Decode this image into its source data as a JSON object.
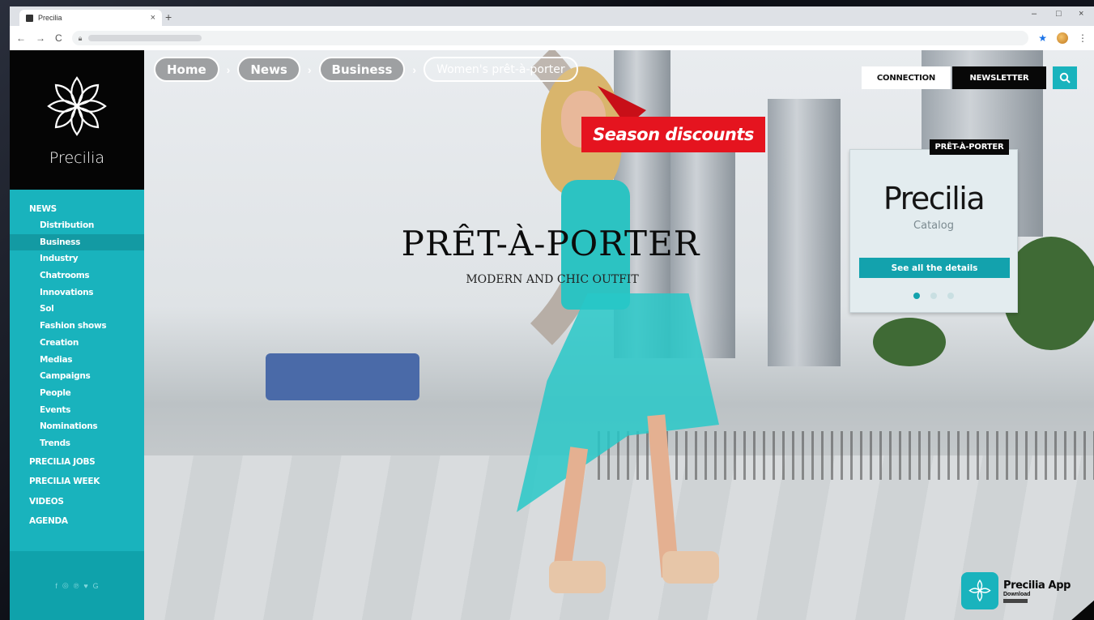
{
  "browser": {
    "tab_title": "Precilia",
    "tab_close": "×",
    "new_tab": "+",
    "window_controls": {
      "minimize": "–",
      "maximize": "□",
      "close": "×"
    },
    "nav": {
      "back": "←",
      "forward": "→",
      "reload": "C",
      "menu": "⋮"
    },
    "address_icon": "lock-icon",
    "bookmark_icon": "star-icon"
  },
  "breadcrumb": [
    {
      "label": "Home"
    },
    {
      "label": "News"
    },
    {
      "label": "Business"
    },
    {
      "label": "Women's prêt-à-porter"
    }
  ],
  "breadcrumb_separator": "›",
  "header": {
    "connection_label": "CONNECTION",
    "newsletter_label": "NEWSLETTER",
    "search_icon": "search-icon"
  },
  "brand": {
    "name": "Precilia",
    "logo_icon": "lotus-mandala-icon"
  },
  "sidebar": {
    "accent_color": "#19b3bd",
    "sections": [
      {
        "label": "NEWS",
        "items": [
          {
            "label": "Distribution",
            "active": false
          },
          {
            "label": "Business",
            "active": true
          },
          {
            "label": "Industry",
            "active": false
          },
          {
            "label": "Chatrooms",
            "active": false
          },
          {
            "label": "Innovations",
            "active": false
          },
          {
            "label": "Sol",
            "active": false
          },
          {
            "label": "Fashion shows",
            "active": false
          },
          {
            "label": "Creation",
            "active": false
          },
          {
            "label": "Medias",
            "active": false
          },
          {
            "label": "Campaigns",
            "active": false
          },
          {
            "label": "People",
            "active": false
          },
          {
            "label": "Events",
            "active": false
          },
          {
            "label": "Nominations",
            "active": false
          },
          {
            "label": "Trends",
            "active": false
          }
        ]
      },
      {
        "label": "PRECILIA JOBS"
      },
      {
        "label": "PRECILIA WEEK"
      },
      {
        "label": "VIDEOS"
      },
      {
        "label": "AGENDA"
      }
    ],
    "social_icons": [
      "facebook-icon",
      "instagram-icon",
      "pinterest-icon",
      "twitter-icon",
      "google-plus-icon"
    ]
  },
  "hero": {
    "promo": "Season discounts",
    "promo_color": "#e5141f",
    "headline": "PRÊT-À-PORTER",
    "subheadline": "MODERN AND CHIC OUTFIT"
  },
  "catalog_card": {
    "tag": "PRÊT-À-PORTER",
    "brand": "Precilia",
    "subtitle": "Catalog",
    "button": "See all the details",
    "slides": 3,
    "active_slide": 1
  },
  "app_badge": {
    "title": "Precilia App",
    "subtitle": "Download"
  }
}
